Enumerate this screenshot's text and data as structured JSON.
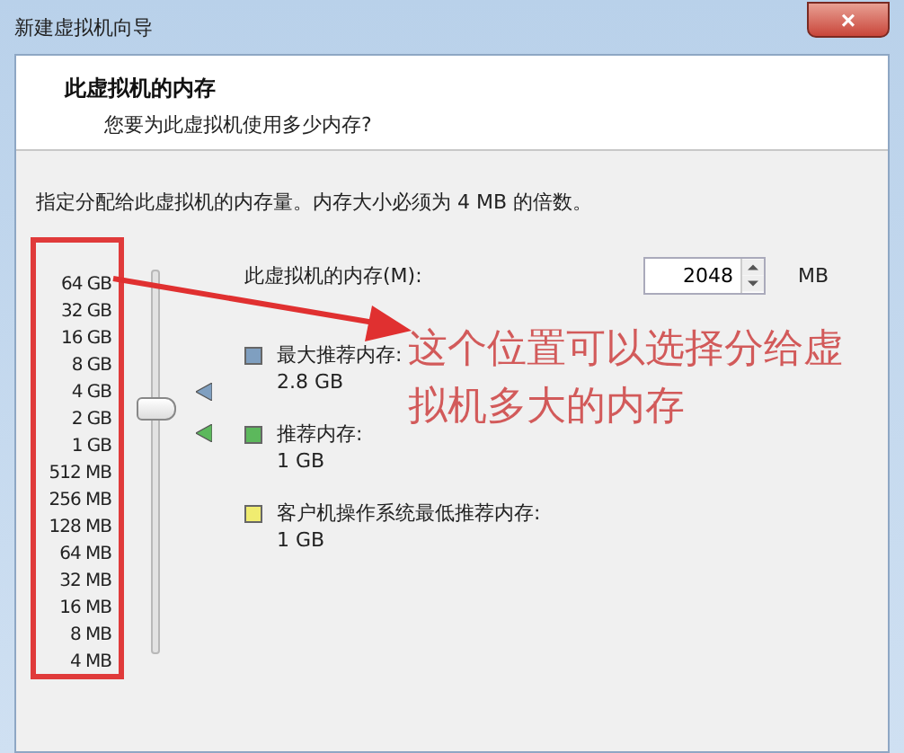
{
  "window": {
    "title": "新建虚拟机向导",
    "close": "×"
  },
  "header": {
    "title": "此虚拟机的内存",
    "subtitle": "您要为此虚拟机使用多少内存?"
  },
  "description": "指定分配给此虚拟机的内存量。内存大小必须为 4 MB 的倍数。",
  "slider": {
    "level": 0.643,
    "scale": [
      "64 GB",
      "32 GB",
      "16 GB",
      "8 GB",
      "4 GB",
      "2 GB",
      "1 GB",
      "512 MB",
      "256 MB",
      "128 MB",
      "64 MB",
      "32 MB",
      "16 MB",
      "8 MB",
      "4 MB"
    ]
  },
  "memory_field": {
    "label": "此虚拟机的内存(M):",
    "value": "2048",
    "unit": "MB"
  },
  "legend": [
    {
      "label": "最大推荐内存:",
      "value": "2.8 GB",
      "color": "#7f9fc0"
    },
    {
      "label": "推荐内存:",
      "value": "1 GB",
      "color": "#5cb85c"
    },
    {
      "label": "客户机操作系统最低推荐内存:",
      "value": "1 GB",
      "color": "#f0ec70"
    }
  ],
  "annotation": {
    "text": "这个位置可以选择分给虚拟机多大的内存"
  }
}
